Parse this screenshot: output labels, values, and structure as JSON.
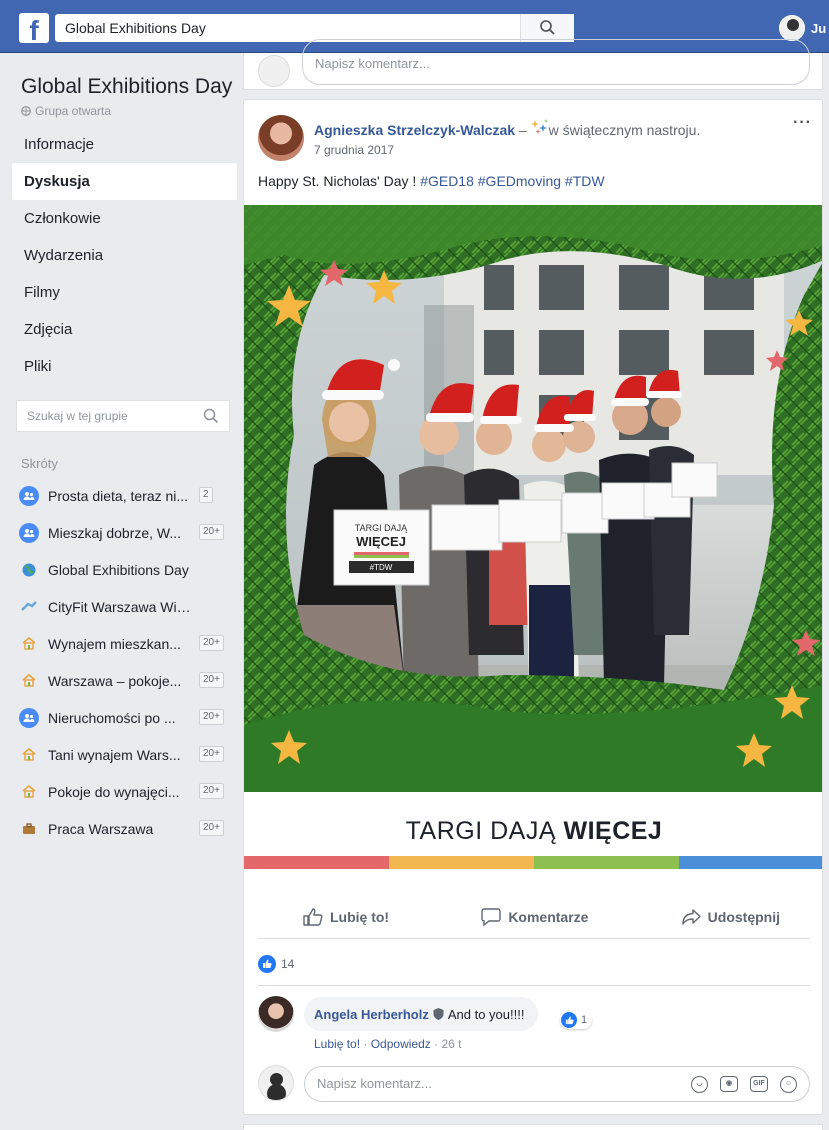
{
  "topbar": {
    "search_value": "Global Exhibitions Day",
    "user_name": "Ju",
    "brand_color": "#4267b2"
  },
  "group": {
    "title": "Global Exhibitions Day",
    "type": "Grupa otwarta"
  },
  "nav": {
    "items": [
      "Informacje",
      "Dyskusja",
      "Członkowie",
      "Wydarzenia",
      "Filmy",
      "Zdjęcia",
      "Pliki"
    ],
    "active": "Dyskusja"
  },
  "group_search": {
    "placeholder": "Szukaj w tej grupie"
  },
  "shortcuts": {
    "heading": "Skróty",
    "items": [
      {
        "label": "Prosta dieta, teraz ni...",
        "count": "2",
        "icon": "group-icon",
        "color": "#4a8cf7"
      },
      {
        "label": "Mieszkaj dobrze, W...",
        "count": "20+",
        "icon": "group-icon",
        "color": "#4a8cf7"
      },
      {
        "label": "Global Exhibitions Day",
        "count": "",
        "icon": "globe-icon",
        "color": "#2aa34a"
      },
      {
        "label": "CityFit Warszawa Wiatr...",
        "count": "",
        "icon": "fitness-icon",
        "color": "#6aa8d8"
      },
      {
        "label": "Wynajem mieszkan...",
        "count": "20+",
        "icon": "house-icon",
        "color": "#e8a23a"
      },
      {
        "label": "Warszawa – pokoje...",
        "count": "20+",
        "icon": "house-icon",
        "color": "#e8a23a"
      },
      {
        "label": "Nieruchomości po ...",
        "count": "20+",
        "icon": "group-icon",
        "color": "#4a8cf7"
      },
      {
        "label": "Tani wynajem Wars...",
        "count": "20+",
        "icon": "house-icon",
        "color": "#e8a23a"
      },
      {
        "label": "Pokoje do wynajęci...",
        "count": "20+",
        "icon": "house-icon",
        "color": "#e8a23a"
      },
      {
        "label": "Praca Warszawa",
        "count": "20+",
        "icon": "briefcase-icon",
        "color": "#b07a3a"
      }
    ]
  },
  "composer_placeholder": "Napisz komentarz...",
  "post": {
    "author": "Agnieszka Strzelczyk-Walczak",
    "separator": " – ",
    "feeling": "w świątecznym nastroju.",
    "date": "7 grudnia 2017",
    "text": "Happy St. Nicholas' Day ! ",
    "hashtags": "#GED18 #GEDmoving #TDW",
    "sign_text": [
      "TARGI DAJĄ",
      "WIĘCEJ",
      "#TDW"
    ],
    "banner_regular": "TARGI DAJĄ ",
    "banner_bold": "WIĘCEJ",
    "stripe_colors": [
      "#e2686b",
      "#f2b84f",
      "#8cc152",
      "#4a90d9"
    ],
    "actions": {
      "like": "Lubię to!",
      "comment": "Komentarze",
      "share": "Udostępnij"
    },
    "like_count": "14"
  },
  "comment": {
    "author": "Angela Herberholz",
    "text": "And to you!!!!",
    "likes": "1",
    "like_link": "Lubię to!",
    "reply_link": "Odpowiedz",
    "sep": " · ",
    "time": "26 t"
  }
}
